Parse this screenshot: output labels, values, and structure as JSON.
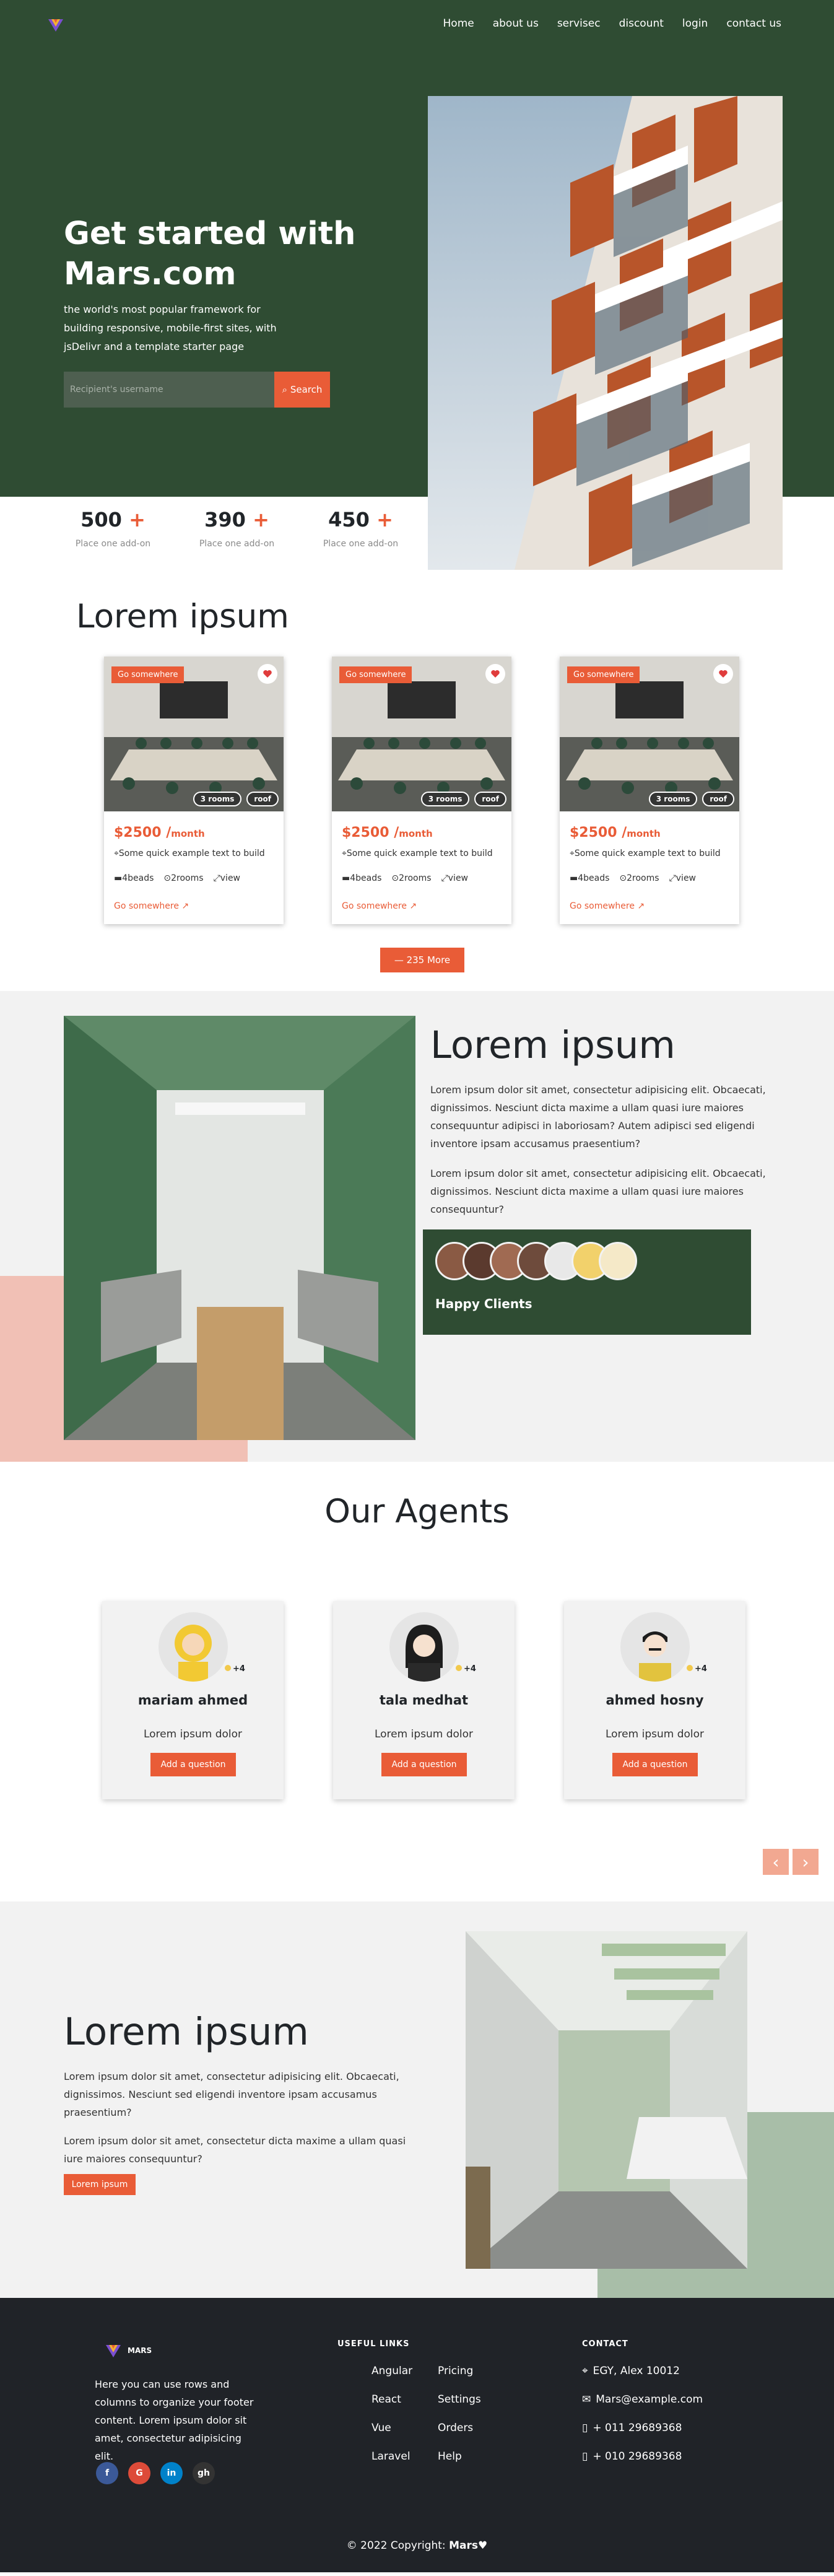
{
  "nav": {
    "items": [
      "Home",
      "about us",
      "servisec",
      "discount",
      "login",
      "contact us"
    ]
  },
  "hero": {
    "title": "Get started with Mars.com",
    "description": "the world's most popular framework for building responsive, mobile-first sites, with jsDelivr and a template starter page",
    "search_placeholder": "Recipient's username",
    "search_button": "Search"
  },
  "stats": [
    {
      "value": "500",
      "plus": "+",
      "label": "Place one add-on"
    },
    {
      "value": "390",
      "plus": "+",
      "label": "Place one add-on"
    },
    {
      "value": "450",
      "plus": "+",
      "label": "Place one add-on"
    }
  ],
  "listing": {
    "title": "Lorem ipsum",
    "cards": [
      {
        "badge": "Go somewhere",
        "tag1": "3 rooms",
        "tag2": "roof",
        "price": "$2500 /",
        "per": "month",
        "address": "Some quick example text to build",
        "beds": "4beads",
        "rooms": "2rooms",
        "view": "view",
        "link": "Go somewhere ↗"
      },
      {
        "badge": "Go somewhere",
        "tag1": "3 rooms",
        "tag2": "roof",
        "price": "$2500 /",
        "per": "month",
        "address": "Some quick example text to build",
        "beds": "4beads",
        "rooms": "2rooms",
        "view": "view",
        "link": "Go somewhere ↗"
      },
      {
        "badge": "Go somewhere",
        "tag1": "3 rooms",
        "tag2": "roof",
        "price": "$2500 /",
        "per": "month",
        "address": "Some quick example text to build",
        "beds": "4beads",
        "rooms": "2rooms",
        "view": "view",
        "link": "Go somewhere ↗"
      }
    ],
    "more_button": "— 235 More"
  },
  "about": {
    "title": "Lorem ipsum",
    "p1": "Lorem ipsum dolor sit amet, consectetur adipisicing elit. Obcaecati, dignissimos. Nesciunt dicta maxime a ullam quasi iure maiores consequuntur adipisci in laboriosam? Autem adipisci sed eligendi inventore ipsam accusamus praesentium?",
    "p2": "Lorem ipsum dolor sit amet, consectetur adipisicing elit. Obcaecati, dignissimos. Nesciunt dicta maxime a ullam quasi iure maiores consequuntur?",
    "clients_label": "Happy Clients"
  },
  "agents": {
    "title": "Our Agents",
    "items": [
      {
        "name": "mariam ahmed",
        "role": "Lorem ipsum dolor",
        "button": "Add a question",
        "plus": "+4"
      },
      {
        "name": "tala medhat",
        "role": "Lorem ipsum dolor",
        "button": "Add a question",
        "plus": "+4"
      },
      {
        "name": "ahmed hosny",
        "role": "Lorem ipsum dolor",
        "button": "Add a question",
        "plus": "+4"
      }
    ],
    "prev": "‹",
    "next": "›"
  },
  "feature": {
    "title": "Lorem ipsum",
    "p1": "Lorem ipsum dolor sit amet, consectetur adipisicing elit. Obcaecati, dignissimos. Nesciunt sed eligendi inventore ipsam accusamus praesentium?",
    "p2": "Lorem ipsum dolor sit amet, consectetur dicta maxime a ullam quasi iure maiores consequuntur?",
    "button": "Lorem ipsum"
  },
  "footer": {
    "logo_text": "MARS",
    "text": "Here you can use rows and columns to organize your footer content. Lorem ipsum dolor sit amet, consectetur adipisicing elit.",
    "useful_links_heading": "USEFUL LINKS",
    "links_col1": [
      "Angular",
      "React",
      "Vue",
      "Laravel"
    ],
    "links_col2": [
      "Pricing",
      "Settings",
      "Orders",
      "Help"
    ],
    "contact_heading": "CONTACT",
    "contact": [
      "EGY, Alex 10012",
      "Mars@example.com",
      "+ 011 29689368",
      "+ 010 29689368"
    ],
    "social": [
      "f",
      "G",
      "in",
      "gh"
    ],
    "copyright": "© 2022 Copyright:",
    "brand": "Mars♥"
  },
  "colors": {
    "accent": "#e95c37",
    "dark_green": "#2f4c33",
    "footer_bg": "#202328"
  }
}
